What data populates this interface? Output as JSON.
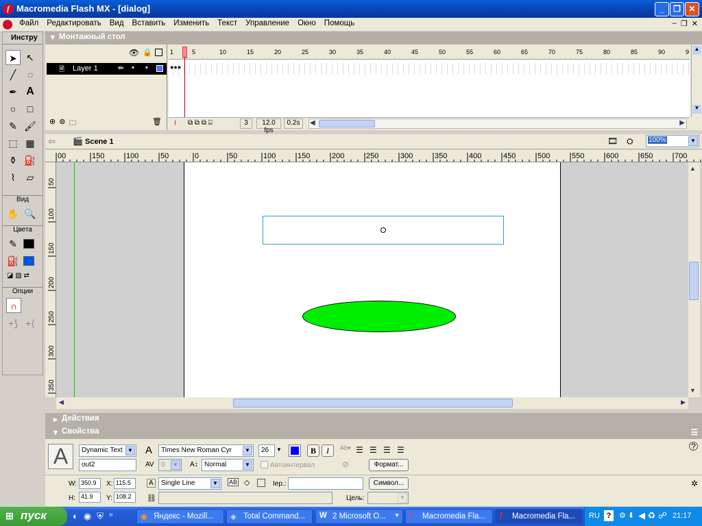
{
  "window": {
    "title": "Macromedia Flash MX - [dialog]"
  },
  "menu": [
    "Файл",
    "Редактировать",
    "Вид",
    "Вставить",
    "Изменить",
    "Текст",
    "Управление",
    "Окно",
    "Помощь"
  ],
  "tools": {
    "header": "Инстру",
    "sections": {
      "view": "Вид",
      "colors": "Цвета",
      "options": "Опции"
    }
  },
  "timeline": {
    "header": "Монтажный стол",
    "layer_name": "Layer 1",
    "frame_ticks": [
      "1",
      "5",
      "10",
      "15",
      "20",
      "25",
      "30",
      "35",
      "40",
      "45",
      "50",
      "55",
      "60",
      "65",
      "70",
      "75",
      "80",
      "85",
      "90",
      "9"
    ],
    "current_frame": "3",
    "fps": "12.0 fps",
    "time": "0.2s"
  },
  "editbar": {
    "scene": "Scene 1",
    "zoom": "100%"
  },
  "rulers": {
    "h": [
      "00",
      "150",
      "100",
      "50",
      "0",
      "50",
      "100",
      "150",
      "200",
      "250",
      "300",
      "350",
      "400",
      "450",
      "500",
      "550",
      "600",
      "650",
      "700",
      "7"
    ],
    "v": [
      "50",
      "100",
      "150",
      "200",
      "250",
      "300",
      "350"
    ]
  },
  "panels": {
    "actions": "Действия",
    "properties": "Свойства"
  },
  "properties": {
    "text_type": "Dynamic Text",
    "instance_name": "out2",
    "font": "Times New Roman Cyr",
    "font_size": "26",
    "tracking": "0",
    "baseline": "Normal",
    "autokern": "Автоинтервал",
    "format_button": "Формат...",
    "w_label": "W:",
    "w": "350.9",
    "x_label": "X:",
    "x": "115.5",
    "h_label": "H:",
    "h": "41.9",
    "y_label": "Y:",
    "y": "108.2",
    "line_type": "Single Line",
    "var_label": "Iер.:",
    "var_value": "",
    "symbol_button": "Символ...",
    "target_label": "Цель:",
    "bold": "B",
    "italic": "I",
    "text_color": "#0000ff"
  },
  "taskbar": {
    "start": "пуск",
    "tasks": [
      "Яндекс - Mozill...",
      "Total Command...",
      "2 Microsoft O...",
      "Macromedia Fla...",
      "Macromedia Fla..."
    ],
    "lang": "RU",
    "clock": "21:17"
  },
  "colors": {
    "stroke": "#000000",
    "fill": "#0055ee",
    "ellipse": "#00ee00",
    "textbox_border": "#3399cc"
  }
}
